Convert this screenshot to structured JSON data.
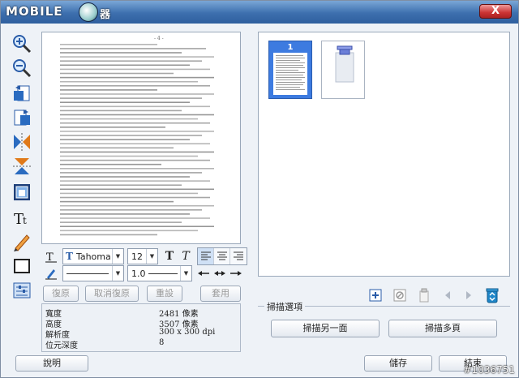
{
  "window": {
    "title_logo_text": "MOBILE",
    "title_app_text": "器",
    "close_label": "X"
  },
  "preview": {
    "page_mark": "- 4 -"
  },
  "format_bar": {
    "font_name": "Tahoma",
    "font_size": "12",
    "bold_label": "T",
    "italic_label": "T",
    "line_width": "1.0"
  },
  "edit_buttons": {
    "undo": "復原",
    "cancel_undo": "取消復原",
    "reset": "重設",
    "apply": "套用"
  },
  "image_info": {
    "rows": [
      {
        "key": "寬度",
        "value": "2481 像素"
      },
      {
        "key": "高度",
        "value": "3507 像素"
      },
      {
        "key": "解析度",
        "value": "300 x 300 dpi"
      },
      {
        "key": "位元深度",
        "value": "8"
      }
    ]
  },
  "thumbnails": [
    {
      "page": "1",
      "selected": true
    },
    {
      "page": "",
      "selected": false
    }
  ],
  "scan_options": {
    "title": "掃描選項",
    "scan_other_side": "掃描另一面",
    "scan_multi": "掃描多頁"
  },
  "footer": {
    "help": "說明",
    "save": "儲存",
    "finish": "結束"
  },
  "watermark": "#1036751",
  "colors": {
    "selected_thumb": "#3d7be0",
    "title_bar": "#3d6fae",
    "recycle": "#1f86c8"
  }
}
